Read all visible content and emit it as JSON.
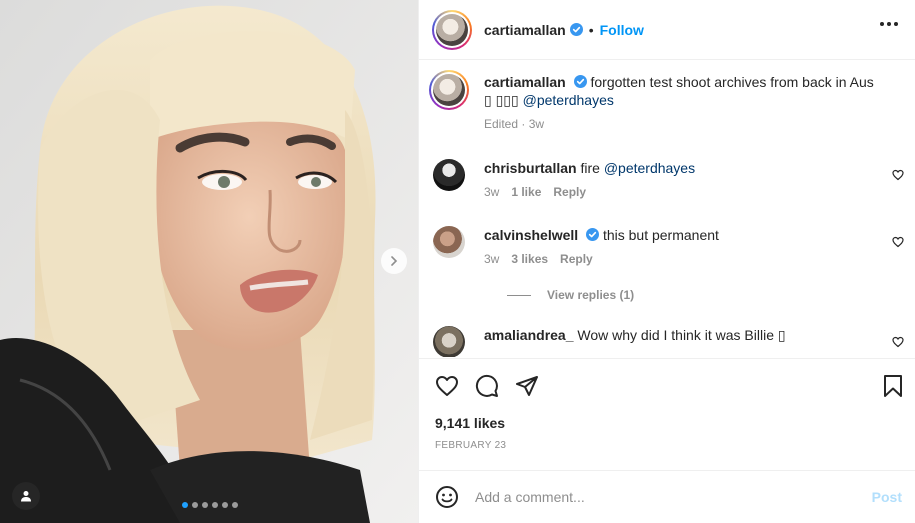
{
  "post": {
    "author": "cartiamallan",
    "follow_label": "Follow",
    "bullet": "•",
    "caption": {
      "username": "cartiamallan",
      "text": "forgotten test shoot archives from back in Aus ▯ ▯▯▯ ",
      "mention": "@peterdhayes",
      "edited": "Edited",
      "time": "3w"
    },
    "media": {
      "dots_total": 6,
      "active_dot": 0
    }
  },
  "comments": [
    {
      "username": "chrisburtallan",
      "verified": false,
      "text": "fire ",
      "mention": "@peterdhayes",
      "time": "3w",
      "likes": "1 like",
      "reply": "Reply"
    },
    {
      "username": "calvinshelwell",
      "verified": true,
      "text": "this but permanent",
      "mention": "",
      "time": "3w",
      "likes": "3 likes",
      "reply": "Reply"
    },
    {
      "username": "amaliandrea_",
      "verified": false,
      "text": "Wow why did I think it was Billie ▯",
      "mention": "",
      "time": "",
      "likes": "",
      "reply": ""
    }
  ],
  "view_replies": "View replies (1)",
  "likes_count": "9,141 likes",
  "date": "FEBRUARY 23",
  "add_comment": {
    "placeholder": "Add a comment...",
    "post_label": "Post"
  },
  "colors": {
    "accent": "#0095f6",
    "verified": "#3897f0",
    "muted": "#8e8e8e",
    "post_disabled": "#b2dffc"
  },
  "icons": [
    "verified-badge-icon",
    "more-options-icon",
    "heart-icon",
    "comment-icon",
    "share-icon",
    "bookmark-icon",
    "emoji-icon",
    "chevron-right-icon",
    "user-tag-icon"
  ]
}
